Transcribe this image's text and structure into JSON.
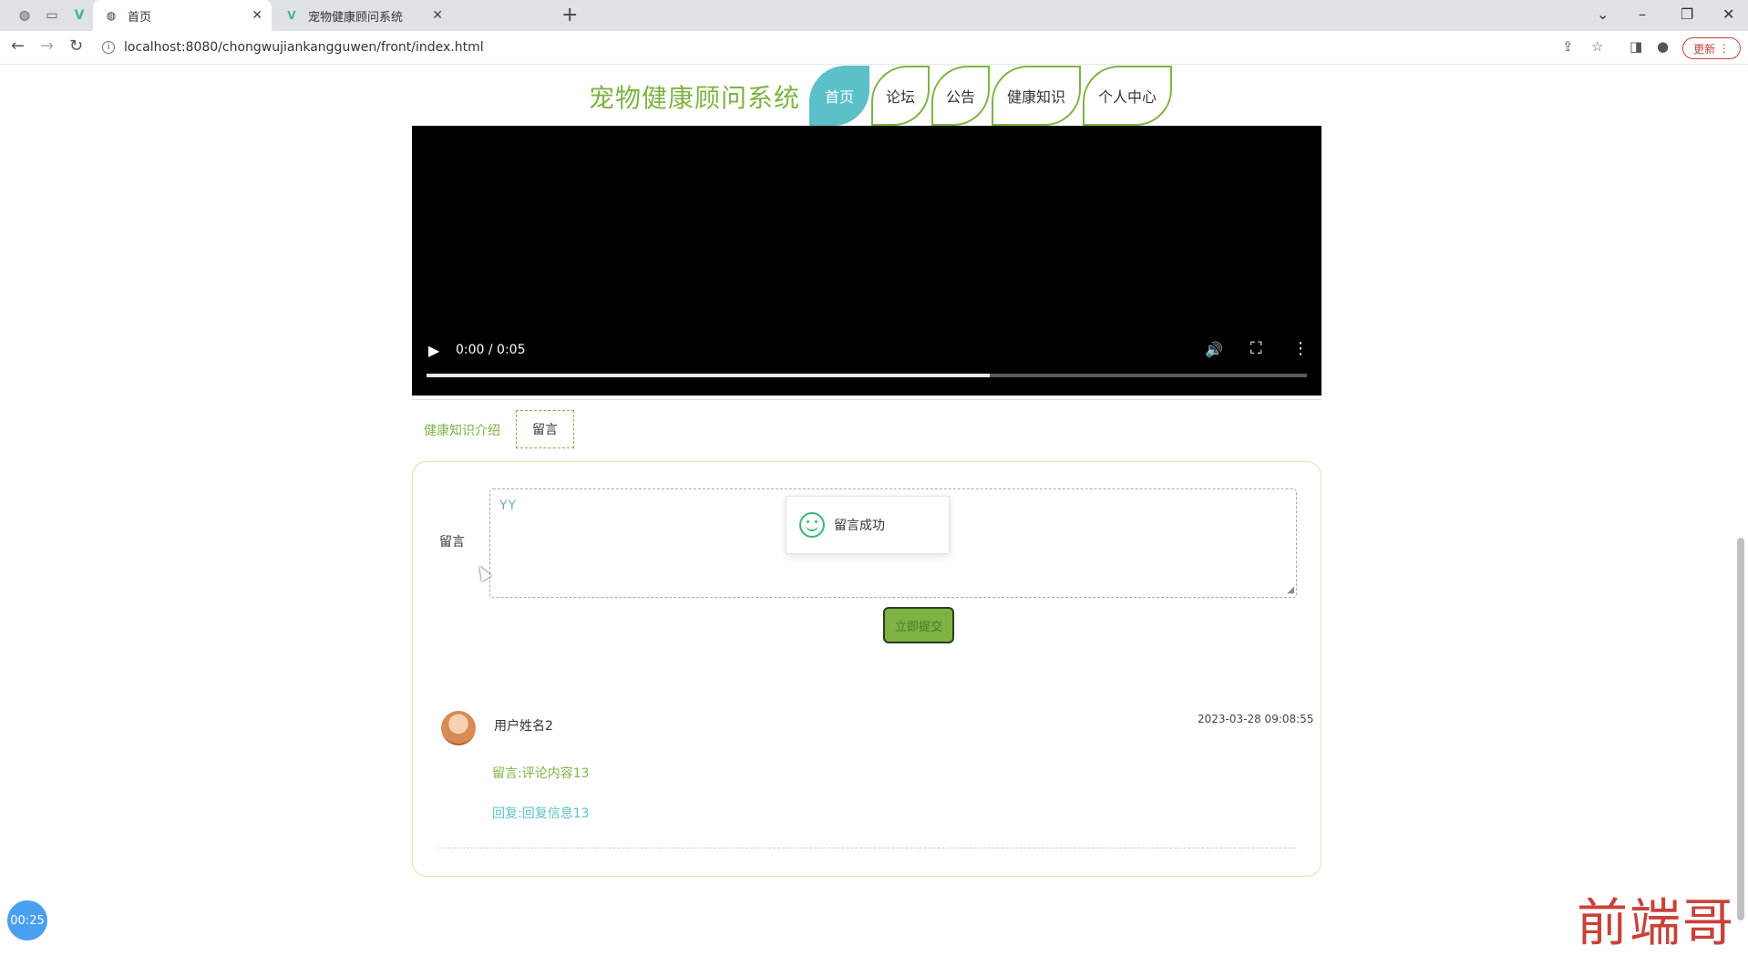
{
  "browser": {
    "tabs": [
      {
        "title": "首页",
        "active": true
      },
      {
        "title": "宠物健康顾问系统",
        "active": false
      }
    ],
    "url": "localhost:8080/chongwujiankangguwen/front/index.html",
    "update_label": "更新"
  },
  "site": {
    "title": "宠物健康顾问系统",
    "nav": [
      {
        "label": "首页",
        "active": true
      },
      {
        "label": "论坛",
        "active": false
      },
      {
        "label": "公告",
        "active": false
      },
      {
        "label": "健康知识",
        "active": false
      },
      {
        "label": "个人中心",
        "active": false
      }
    ]
  },
  "video": {
    "time": "0:00 / 0:05",
    "progress": 0.64
  },
  "detail_tabs": {
    "intro": "健康知识介绍",
    "comment": "留言"
  },
  "comment_form": {
    "label": "留言",
    "value": "YY",
    "submit_label": "立即提交",
    "toast": "留言成功"
  },
  "comments": [
    {
      "user": "用户姓名2",
      "time": "2023-03-28 09:08:55",
      "content": "留言:评论内容13",
      "reply": "回复:回复信息13"
    }
  ],
  "overlay": {
    "timer": "00:25",
    "watermark": "前端哥"
  },
  "colors": {
    "brand_green": "#7cb342",
    "active_teal": "#5bc0c8"
  }
}
